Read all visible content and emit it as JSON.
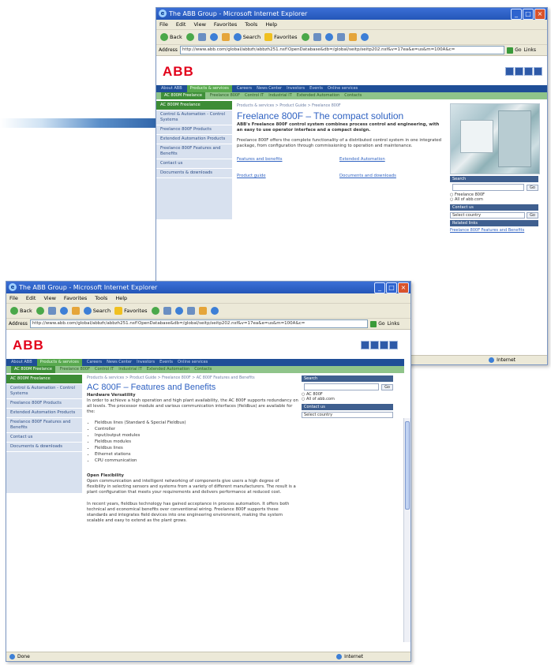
{
  "back_window": {
    "title": "The ABB Group - Microsoft Internet Explorer",
    "menu": [
      "File",
      "Edit",
      "View",
      "Favorites",
      "Tools",
      "Help"
    ],
    "toolbar": {
      "back": "Back",
      "search": "Search",
      "favorites": "Favorites"
    },
    "address_label": "Address",
    "address_value": "http://www.abb.com/global/abbzh/abbzh251.nsf!OpenDatabase&db=/global/seitp/seitp202.nsf&v=17ea&e=us&m=100A&c=",
    "go_label": "Go",
    "links_label": "Links",
    "logo": "ABB",
    "nav_primary": [
      "About ABB",
      "Products & services",
      "Careers",
      "News Center",
      "Investors",
      "Events",
      "Online services"
    ],
    "nav_secondary": [
      "AC 800M Freelance",
      "Freelance 800F",
      "Control IT",
      "Industrial IT",
      "Extended Automation",
      "Contacts"
    ],
    "sidebar": [
      "AC 800M Freelance",
      "Control & Automation - Control Systems",
      "Freelance 800F Products",
      "Extended Automation Products",
      "Freelance 800F Features and Benefits",
      "Contact us",
      "Documents & downloads"
    ],
    "breadcrumb": "Products & services > Product Guide > Freelance 800F",
    "page_title": "Freelance 800F – The compact solution",
    "intro": "ABB's Freelance 800F control system combines process control and engineering, with an easy to use operator interface and a compact design.",
    "body": "Freelance 800F offers the complete functionality of a distributed control system in one integrated package, from configuration through commissioning to operation and maintenance.",
    "links": [
      "Features and benefits",
      "Extended Automation",
      "Product guide",
      "Documents and downloads"
    ],
    "right": {
      "search_head": "Search",
      "search_btn": "Go",
      "opt1": "Freelance 800F",
      "opt2": "All of abb.com",
      "contact_head": "Contact us",
      "contact_select": "Select country",
      "contact_btn": "Go",
      "related_head": "Related links",
      "related_link": "Freelance 800F Features and Benefits"
    },
    "status_left": "",
    "status_right": "Internet"
  },
  "front_window": {
    "title": "The ABB Group - Microsoft Internet Explorer",
    "menu": [
      "File",
      "Edit",
      "View",
      "Favorites",
      "Tools",
      "Help"
    ],
    "toolbar": {
      "back": "Back",
      "search": "Search",
      "favorites": "Favorites"
    },
    "address_label": "Address",
    "address_value": "http://www.abb.com/global/abbzh/abbzh251.nsf!OpenDatabase&db=/global/seitp/seitp202.nsf&v=17ea&e=us&m=100A&c=",
    "go_label": "Go",
    "links_label": "Links",
    "logo": "ABB",
    "nav_primary": [
      "About ABB",
      "Products & services",
      "Careers",
      "News Center",
      "Investors",
      "Events",
      "Online services"
    ],
    "nav_secondary": [
      "AC 800M Freelance",
      "Freelance 800F",
      "Control IT",
      "Industrial IT",
      "Extended Automation",
      "Contacts"
    ],
    "sidebar": [
      "AC 800M Freelance",
      "Control & Automation - Control Systems",
      "Freelance 800F Products",
      "Extended Automation Products",
      "Freelance 800F Features and Benefits",
      "Contact us",
      "Documents & downloads"
    ],
    "breadcrumb": "Products & services > Product Guide > Freelance 800F > AC 800F Features and Benefits",
    "page_title": "AC 800F – Features and Benefits",
    "subhead": "Hardware Versatility",
    "intro": "In order to achieve a high operation and high plant availability, the AC 800F supports redundancy on all levels. The processor module and various communication interfaces (fieldbus) are available for the:",
    "bullets": [
      "Fieldbus lines (Standard & Special Fieldbus)",
      "Controller",
      "Input/output modules",
      "Fieldbus modules",
      "Fieldbus lines",
      "Ethernet stations",
      "CPU communication"
    ],
    "section2_head": "Open Flexibility",
    "section2_p1": "Open communication and intelligent networking of components give users a high degree of flexibility in selecting sensors and systems from a variety of different manufacturers. The result is a plant configuration that meets your requirements and delivers performance at reduced cost.",
    "section2_p2": "In recent years, fieldbus technology has gained acceptance in process automation. It offers both technical and economical benefits over conventional wiring. Freelance 800F supports these standards and integrates field devices into one engineering environment, making the system scalable and easy to extend as the plant grows.",
    "right": {
      "search_head": "Search",
      "search_btn": "Go",
      "opt1": "AC 800F",
      "opt2": "All of abb.com",
      "contact_head": "Contact us",
      "contact_select": "Select country"
    },
    "status_left": "Done",
    "status_right": "Internet"
  }
}
